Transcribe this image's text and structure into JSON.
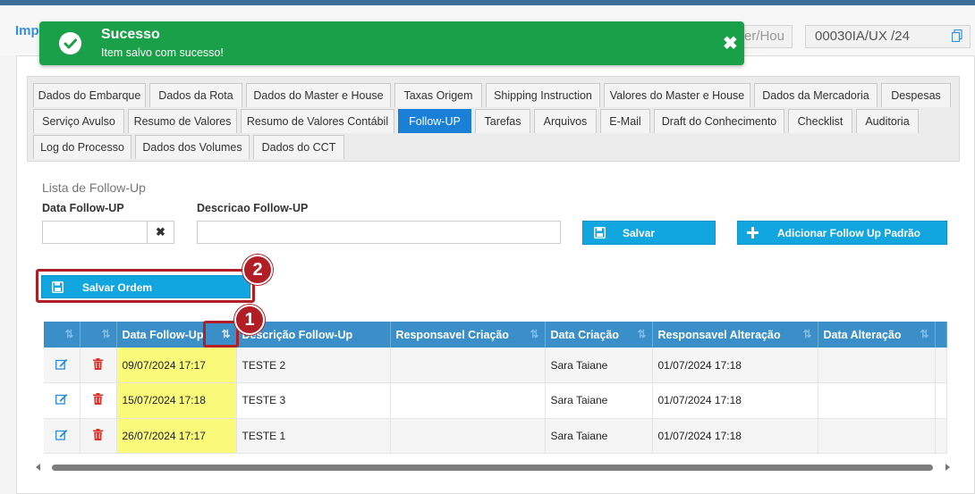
{
  "header": {
    "title": "Imp",
    "field1_value": "ster/Hou",
    "field2_value": "00030IA/UX /24"
  },
  "toast": {
    "title": "Sucesso",
    "message": "Item salvo com sucesso!",
    "close": "✖"
  },
  "tabs": [
    {
      "label": "Dados do Embarque"
    },
    {
      "label": "Dados da Rota"
    },
    {
      "label": "Dados do Master e House"
    },
    {
      "label": "Taxas Origem"
    },
    {
      "label": "Shipping Instruction"
    },
    {
      "label": "Valores do Master e House"
    },
    {
      "label": "Dados da Mercadoria"
    },
    {
      "label": "Despesas"
    },
    {
      "label": "Serviço Avulso"
    },
    {
      "label": "Resumo de Valores"
    },
    {
      "label": "Resumo de Valores Contábil"
    },
    {
      "label": "Follow-UP"
    },
    {
      "label": "Tarefas"
    },
    {
      "label": "Arquivos"
    },
    {
      "label": "E-Mail"
    },
    {
      "label": "Draft do Conhecimento"
    },
    {
      "label": "Checklist"
    },
    {
      "label": "Auditoria"
    },
    {
      "label": "Log do Processo"
    },
    {
      "label": "Dados dos Volumes"
    },
    {
      "label": "Dados do CCT"
    }
  ],
  "active_tab": "Follow-UP",
  "form": {
    "section_title": "Lista de Follow-Up",
    "date_label": "Data Follow-UP",
    "date_value": "",
    "clear_symbol": "✖",
    "desc_label": "Descricao Follow-UP",
    "desc_value": "",
    "save_label": "Salvar",
    "add_default_label": "Adicionar Follow Up Padrão",
    "save_order_label": "Salvar Ordem"
  },
  "annotations": {
    "marker1": "1",
    "marker2": "2"
  },
  "table": {
    "columns": [
      "",
      "",
      "Data Follow-Up",
      "Descrição Follow-Up",
      "Responsavel Criação",
      "Data Criação",
      "Responsavel Alteração",
      "Data Alteração",
      ""
    ],
    "rows": [
      {
        "date": "09/07/2024 17:17",
        "desc": "TESTE 2",
        "created_by": "",
        "created_at": "Sara Taiane",
        "changed_by": "01/07/2024 17:18",
        "changed_at": ""
      },
      {
        "date": "15/07/2024 17:18",
        "desc": "TESTE 3",
        "created_by": "",
        "created_at": "Sara Taiane",
        "changed_by": "01/07/2024 17:18",
        "changed_at": ""
      },
      {
        "date": "26/07/2024 17:17",
        "desc": "TESTE 1",
        "created_by": "",
        "created_at": "Sara Taiane",
        "changed_by": "01/07/2024 17:18",
        "changed_at": ""
      }
    ]
  },
  "colors": {
    "accent": "#1a7fd6",
    "button": "#12a6e0",
    "toast": "#1aa048",
    "highlight": "#fafa7a",
    "annotation": "#b21e25"
  }
}
